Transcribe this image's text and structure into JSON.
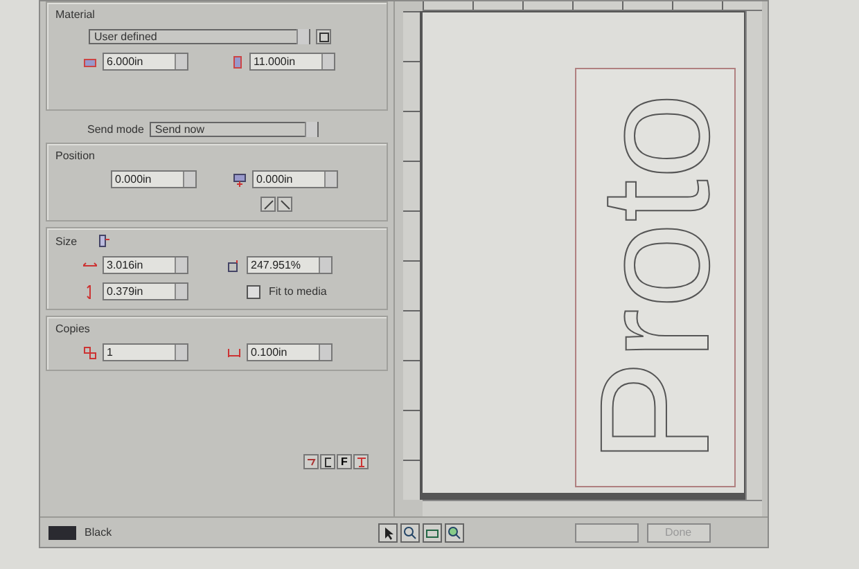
{
  "material": {
    "label": "Material",
    "value": "User defined",
    "width": "6.000in",
    "height": "11.000in"
  },
  "send_mode": {
    "label": "Send mode",
    "value": "Send now"
  },
  "position": {
    "label": "Position",
    "x": "0.000in",
    "y": "0.000in"
  },
  "size": {
    "label": "Size",
    "width": "3.016in",
    "scale": "247.951%",
    "height": "0.379in",
    "fit_to_media": {
      "label": "Fit to media",
      "checked": false
    }
  },
  "copies": {
    "label": "Copies",
    "count": "1",
    "spacing": "0.100in"
  },
  "panel_tools": {
    "text_button": "F"
  },
  "canvas": {
    "text": "Proto"
  },
  "status": {
    "color_label": "Black",
    "color": "#2a2a30"
  },
  "done_button": {
    "label": "Done",
    "disabled": true
  }
}
